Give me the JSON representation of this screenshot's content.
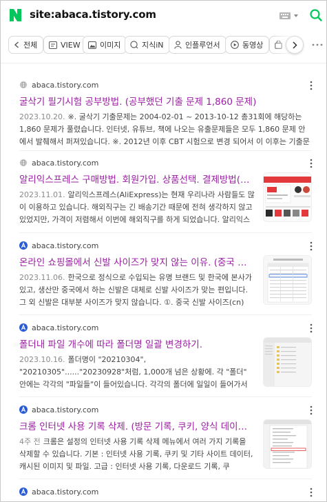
{
  "search": {
    "query": "site:abaca.tistory.com"
  },
  "tabs": [
    {
      "label": "전체",
      "icon": "chevron-left-icon"
    },
    {
      "label": "VIEW",
      "icon": "view-icon"
    },
    {
      "label": "이미지",
      "icon": "image-icon"
    },
    {
      "label": "지식iN",
      "icon": "qa-icon"
    },
    {
      "label": "인플루언서",
      "icon": "person-icon"
    },
    {
      "label": "동영상",
      "icon": "play-icon"
    }
  ],
  "colors": {
    "brand": "#03c75a",
    "title_visited": "#9b1fa3"
  },
  "results": [
    {
      "site": "abaca.tistory.com",
      "favicon": "globe-icon",
      "title": "굴삭기 필기시험 공부방법. (공부했던 기출 문제 1,860 문제)",
      "date": "2023.10.20.",
      "snippet": "※. 굴삭기 기출문제는 2004-02-01 ~ 2013-10-12 총31회에 해당하는 1,860 문제가 풀렸습니다. 인터넷, 유튜브, 책에 나오는 유출문제들은 모두 1,860 문제 안에서 발췌해서 퍼져있습니다. ※. 2012년 이후 CBT 시험으로 변경 되어서 이 이후는 기출문제 자체가"
    },
    {
      "site": "abaca.tistory.com",
      "favicon": "globe-icon",
      "title": "알리익스프레스 구매방법. 회원가입. 상품선택. 결제방법(카카오페이)",
      "date": "2023.11.01.",
      "snippet": "알리익스프레스(AliExpress)는 현재 우리나라 사람들도 많이 이용하고 있습니다. 해외직구는 긴 배송기간 때문에 전혀 생각하지 않고 있었지만, 가격이 저렴해서 이번에 해외직구를 하게 되었습니다. 알리익스"
    },
    {
      "site": "abaca.tistory.com",
      "favicon": "a-icon",
      "title": "온라인 쇼핑몰에서 신발 사이즈가 맞지 않는 이유. (중국 신발사이즈)",
      "date": "2023.11.06.",
      "snippet": "한국으로 정식으로 수입되는 유명 브랜드 및 한국에 본사가 있고, 생산만 중국에서 하는 신발은 대체로 신발 사이즈가 맞는 편입니다. 그 외 신발은 대부분 사이즈가 맞지 않습니다. ①. 중국 신발 사이즈(cn)"
    },
    {
      "site": "abaca.tistory.com",
      "favicon": "a-icon",
      "title": "폴더내 파일 개수에 따라 폴더명 일괄 변경하기.",
      "date": "2023.10.16.",
      "snippet": "폴더명이 \"20210304\", \"20210305\"......\"20230928\"처럼, 1,000개 넘은 상황에. 각 \"폴더\" 안에는 각각의 \"파일들\"이 들어있습니다. 각각의 폴더에 일일이 들어가서 \"파일개수\"를 확인하고, \"20210304\" 폴더 안에"
    },
    {
      "site": "abaca.tistory.com",
      "favicon": "a-icon",
      "title": "크롬 인터넷 사용 기록 삭제. (방문 기록, 쿠키, 양식 데이터 자동완성)",
      "date": "4주 전",
      "snippet": "크롬은 설정의 인터넷 사용 기록 삭제 메뉴에서 여러 가지 기록을 삭제할 수 있습니다. 기본 : 인터넷 사용 기록, 쿠키 및 기타 사이트 데이터, 캐시된 이미지 및 파일. 고급 : 인터넷 사용 기록, 다운로드 기록, 쿠"
    },
    {
      "site": "abaca.tistory.com",
      "favicon": "a-icon"
    }
  ]
}
